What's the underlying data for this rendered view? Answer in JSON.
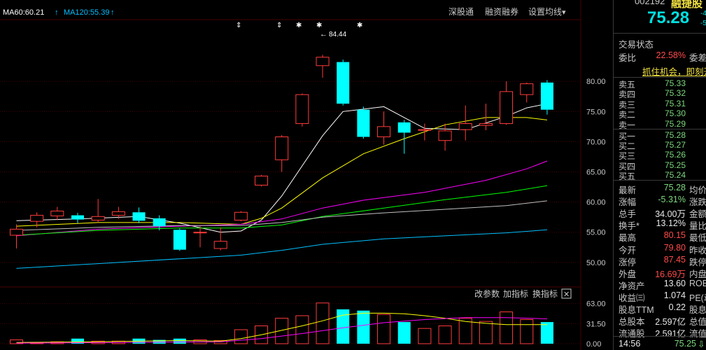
{
  "top_bar": {
    "ma60_label": "MA60:60.21",
    "ma120_label": "MA120:55.39",
    "arrow": "↑",
    "link_1": "深股通",
    "link_2": "融资融券",
    "link_3": "设置均线",
    "dropdown_arrow": "▾",
    "markers": [
      "⇕",
      "⇕",
      "✱",
      "✱",
      "✱"
    ],
    "max_price_label": "84.44",
    "max_price_arrow": "←"
  },
  "volume_toolbar": {
    "btn_params": "改参数",
    "btn_add": "加指标",
    "btn_switch": "换指标",
    "btn_close": "✕"
  },
  "quote_panel": {
    "code": "002192",
    "name": "融捷股",
    "price": "75.28",
    "mini_1": "-4.",
    "mini_2": "-5",
    "section_title": "交易状态",
    "ratio_label": "委比",
    "ratio_value": "22.58%",
    "ratio_cut": "委差",
    "banner": "抓住机会，即刻开",
    "asks": [
      {
        "label": "卖五",
        "price": "75.33"
      },
      {
        "label": "卖四",
        "price": "75.32"
      },
      {
        "label": "卖三",
        "price": "75.31"
      },
      {
        "label": "卖二",
        "price": "75.30"
      },
      {
        "label": "卖一",
        "price": "75.29"
      }
    ],
    "bids": [
      {
        "label": "买一",
        "price": "75.28"
      },
      {
        "label": "买二",
        "price": "75.27"
      },
      {
        "label": "买三",
        "price": "75.26"
      },
      {
        "label": "买四",
        "price": "75.25"
      },
      {
        "label": "买五",
        "price": "75.24"
      }
    ],
    "stats": [
      {
        "label": "最新",
        "value": "75.28",
        "cut": "均价",
        "color": "gr"
      },
      {
        "label": "涨幅",
        "value": "-5.31%",
        "cut": "涨跌",
        "color": "gr"
      },
      {
        "label": "总手",
        "value": "34.00万",
        "cut": "金额",
        "color": "wh"
      },
      {
        "label": "换手*",
        "value": "13.12%",
        "cut": "量比",
        "color": "wh"
      },
      {
        "label": "最高",
        "value": "80.15",
        "cut": "最低",
        "color": "up"
      },
      {
        "label": "今开",
        "value": "79.80",
        "cut": "昨收",
        "color": "up"
      },
      {
        "label": "涨停",
        "value": "87.45",
        "cut": "跌停",
        "color": "up"
      },
      {
        "label": "外盘",
        "value": "16.69万",
        "cut": "内盘",
        "color": "up"
      },
      {
        "label": "净资产",
        "value": "13.60",
        "cut": "ROE",
        "color": "wh"
      },
      {
        "label": "收益㈢",
        "value": "1.074",
        "cut": "PE(动",
        "color": "wh"
      },
      {
        "label": "股息TTM",
        "value": "0.22",
        "cut": "股息",
        "color": "wh"
      },
      {
        "label": "总股本",
        "value": "2.597亿",
        "cut": "总值",
        "color": "wh"
      },
      {
        "label": "流通股",
        "value": "2.591亿",
        "cut": "流值",
        "color": "wh"
      }
    ],
    "tick_time": "14:56",
    "tick_price": "75.25",
    "tick_arrow": "⇩"
  },
  "colors": {
    "up": "#ff3b3b",
    "down": "#00ffff",
    "ma5": "#ffffff",
    "ma10": "#ffff00",
    "ma20": "#ff00ff",
    "ma30": "#00ff00",
    "ma60": "#c0c0c0",
    "ma120": "#00c0ff",
    "grid": "#4a0000"
  },
  "chart_data": {
    "type": "candlestick",
    "price_axis": {
      "ylim": [
        46.5,
        90
      ],
      "ticks": [
        "80.00",
        "75.00",
        "70.00",
        "65.00",
        "60.00",
        "55.00",
        "50.00"
      ]
    },
    "volume_axis": {
      "ylim": [
        0,
        66
      ],
      "ticks": [
        "63.00",
        "31.50",
        "0.00"
      ]
    },
    "candles": [
      {
        "o": 54.5,
        "c": 55.5,
        "h": 56.3,
        "l": 52.3,
        "v": 6
      },
      {
        "o": 56.8,
        "c": 57.8,
        "h": 58.3,
        "l": 55.8,
        "v": 2
      },
      {
        "o": 57.7,
        "c": 58.5,
        "h": 59.2,
        "l": 57.0,
        "v": 3
      },
      {
        "o": 57.8,
        "c": 57.1,
        "h": 58.2,
        "l": 56.5,
        "v": 8
      },
      {
        "o": 57.0,
        "c": 57.6,
        "h": 60.5,
        "l": 56.6,
        "v": 4
      },
      {
        "o": 57.8,
        "c": 58.4,
        "h": 59.2,
        "l": 57.2,
        "v": 4
      },
      {
        "o": 58.3,
        "c": 56.9,
        "h": 59.1,
        "l": 56.5,
        "v": 8
      },
      {
        "o": 57.3,
        "c": 56.0,
        "h": 57.8,
        "l": 55.3,
        "v": 6
      },
      {
        "o": 55.4,
        "c": 52.1,
        "h": 55.6,
        "l": 51.9,
        "v": 8
      },
      {
        "o": 55.0,
        "c": 55.0,
        "h": 56.0,
        "l": 52.5,
        "v": 6
      },
      {
        "o": 52.3,
        "c": 53.5,
        "h": 55.8,
        "l": 52.0,
        "v": 5
      },
      {
        "o": 57.0,
        "c": 58.3,
        "h": 58.5,
        "l": 56.8,
        "v": 22
      },
      {
        "o": 62.8,
        "c": 64.3,
        "h": 64.5,
        "l": 62.6,
        "v": 28
      },
      {
        "o": 67.0,
        "c": 70.8,
        "h": 71.1,
        "l": 65.0,
        "v": 40
      },
      {
        "o": 73.0,
        "c": 77.8,
        "h": 78.0,
        "l": 72.5,
        "v": 44
      },
      {
        "o": 82.6,
        "c": 84.0,
        "h": 84.4,
        "l": 80.6,
        "v": 64
      },
      {
        "o": 83.2,
        "c": 76.3,
        "h": 83.6,
        "l": 76.0,
        "v": 54
      },
      {
        "o": 75.3,
        "c": 70.8,
        "h": 75.8,
        "l": 70.5,
        "v": 52
      },
      {
        "o": 70.8,
        "c": 72.5,
        "h": 75.0,
        "l": 69.5,
        "v": 46
      },
      {
        "o": 73.2,
        "c": 71.5,
        "h": 73.6,
        "l": 68.0,
        "v": 34
      },
      {
        "o": 72.0,
        "c": 72.0,
        "h": 73.0,
        "l": 70.2,
        "v": 24
      },
      {
        "o": 70.2,
        "c": 71.8,
        "h": 73.0,
        "l": 68.5,
        "v": 28
      },
      {
        "o": 72.0,
        "c": 73.0,
        "h": 76.0,
        "l": 70.2,
        "v": 40
      },
      {
        "o": 72.7,
        "c": 73.0,
        "h": 76.3,
        "l": 71.9,
        "v": 35
      },
      {
        "o": 73.0,
        "c": 78.3,
        "h": 80.0,
        "l": 72.8,
        "v": 50
      },
      {
        "o": 77.8,
        "c": 79.6,
        "h": 79.8,
        "l": 76.5,
        "v": 38
      },
      {
        "o": 79.8,
        "c": 75.3,
        "h": 80.2,
        "l": 74.5,
        "v": 34
      }
    ],
    "ma_lines": {
      "ma5": [
        [
          0,
          56.9
        ],
        [
          3,
          57.2
        ],
        [
          6,
          57.6
        ],
        [
          8,
          56.5
        ],
        [
          10,
          55.0
        ],
        [
          11,
          55.2
        ],
        [
          12,
          57.0
        ],
        [
          13,
          61.0
        ],
        [
          14,
          66.0
        ],
        [
          15,
          71.0
        ],
        [
          16,
          75.0
        ],
        [
          18,
          75.8
        ],
        [
          19,
          74.0
        ],
        [
          20,
          72.2
        ],
        [
          22,
          72.0
        ],
        [
          24,
          74.2
        ],
        [
          25,
          75.6
        ],
        [
          26,
          76.3
        ]
      ],
      "ma10": [
        [
          0,
          56.0
        ],
        [
          4,
          56.6
        ],
        [
          8,
          56.6
        ],
        [
          11,
          56.3
        ],
        [
          12,
          57.3
        ],
        [
          13,
          59.0
        ],
        [
          14,
          61.5
        ],
        [
          15,
          64.0
        ],
        [
          16,
          66.0
        ],
        [
          17,
          68.0
        ],
        [
          19,
          70.5
        ],
        [
          21,
          72.8
        ],
        [
          23,
          74.0
        ],
        [
          25,
          74.0
        ],
        [
          26,
          73.6
        ]
      ],
      "ma20": [
        [
          0,
          54.4
        ],
        [
          4,
          55.5
        ],
        [
          8,
          56.0
        ],
        [
          11,
          56.3
        ],
        [
          13,
          57.2
        ],
        [
          15,
          59.0
        ],
        [
          17,
          60.3
        ],
        [
          20,
          61.6
        ],
        [
          23,
          63.6
        ],
        [
          25,
          65.5
        ],
        [
          26,
          66.8
        ]
      ],
      "ma30": [
        [
          0,
          54.5
        ],
        [
          4,
          55.3
        ],
        [
          8,
          55.7
        ],
        [
          11,
          55.7
        ],
        [
          13,
          56.2
        ],
        [
          15,
          57.6
        ],
        [
          18,
          59.0
        ],
        [
          21,
          60.4
        ],
        [
          24,
          61.6
        ],
        [
          26,
          62.7
        ]
      ],
      "ma60": [
        [
          0,
          55.3
        ],
        [
          4,
          55.8
        ],
        [
          8,
          56.1
        ],
        [
          11,
          56.1
        ],
        [
          13,
          56.6
        ],
        [
          15,
          57.5
        ],
        [
          18,
          58.2
        ],
        [
          21,
          58.8
        ],
        [
          24,
          59.4
        ],
        [
          26,
          60.2
        ]
      ],
      "ma120": [
        [
          0,
          49.0
        ],
        [
          4,
          49.8
        ],
        [
          8,
          50.6
        ],
        [
          11,
          51.2
        ],
        [
          13,
          52.0
        ],
        [
          15,
          53.0
        ],
        [
          18,
          53.9
        ],
        [
          21,
          54.4
        ],
        [
          24,
          54.9
        ],
        [
          26,
          55.4
        ]
      ]
    },
    "vol_ma": {
      "ma5": [
        [
          0,
          2
        ],
        [
          4,
          3
        ],
        [
          8,
          5
        ],
        [
          10,
          4
        ],
        [
          11,
          8
        ],
        [
          12,
          14
        ],
        [
          13,
          21
        ],
        [
          14,
          28
        ],
        [
          15,
          36
        ],
        [
          16,
          45
        ],
        [
          17,
          48
        ],
        [
          18,
          48
        ],
        [
          19,
          47
        ],
        [
          20,
          44
        ],
        [
          21,
          40
        ],
        [
          22,
          35
        ],
        [
          23,
          32
        ],
        [
          24,
          30
        ],
        [
          25,
          30
        ],
        [
          26,
          30
        ]
      ],
      "ma10": [
        [
          0,
          1
        ],
        [
          5,
          2
        ],
        [
          10,
          3
        ],
        [
          12,
          8
        ],
        [
          14,
          16
        ],
        [
          16,
          25
        ],
        [
          18,
          33
        ],
        [
          20,
          38
        ],
        [
          22,
          41
        ],
        [
          24,
          41
        ],
        [
          26,
          39
        ]
      ]
    }
  }
}
